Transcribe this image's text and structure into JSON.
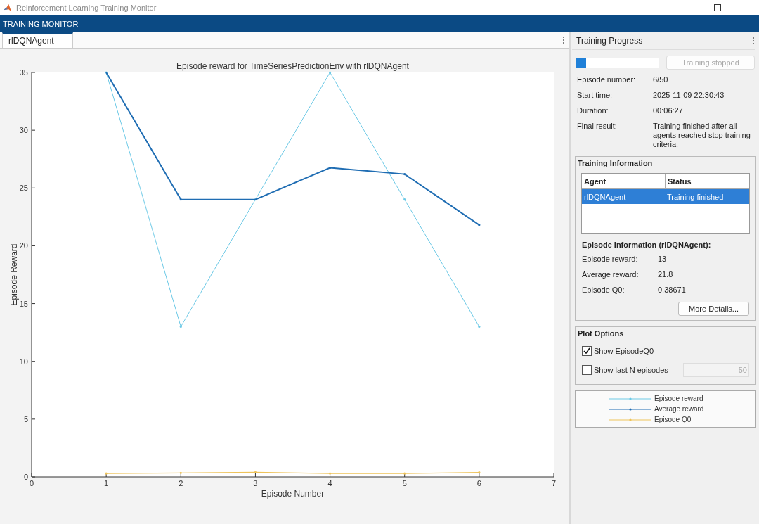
{
  "window": {
    "title": "Reinforcement Learning Training Monitor"
  },
  "header": {
    "title": "TRAINING MONITOR"
  },
  "tabs": [
    {
      "label": "rlDQNAgent",
      "selected": true
    }
  ],
  "chart": {
    "chart_data": {
      "type": "line",
      "title": "Episode reward for TimeSeriesPredictionEnv with rlDQNAgent",
      "xlabel": "Episode Number",
      "ylabel": "Episode Reward",
      "x": [
        1,
        2,
        3,
        4,
        5,
        6
      ],
      "xlim": [
        0,
        7
      ],
      "ylim": [
        0,
        35
      ],
      "xticks": [
        0,
        1,
        2,
        3,
        4,
        5,
        6,
        7
      ],
      "yticks": [
        0,
        5,
        10,
        15,
        20,
        25,
        30,
        35
      ],
      "series": [
        {
          "name": "Episode reward",
          "color": "#6cc9e6",
          "values": [
            35,
            13,
            24,
            35,
            24,
            13
          ]
        },
        {
          "name": "Average reward",
          "color": "#1f6db3",
          "values": [
            35,
            24,
            24,
            26.75,
            26.2,
            21.8
          ]
        },
        {
          "name": "Episode Q0",
          "color": "#eec35a",
          "values": [
            0.3,
            0.35,
            0.4,
            0.3,
            0.3,
            0.39
          ]
        }
      ]
    }
  },
  "progress": {
    "title": "Training Progress",
    "level": 0.12,
    "button": {
      "label": "Training stopped",
      "disabled": true
    },
    "fields": [
      {
        "label": "Episode number:",
        "value": "6/50"
      },
      {
        "label": "Start time:",
        "value": "2025-11-09 22:30:43"
      },
      {
        "label": "Duration:",
        "value": "00:06:27"
      },
      {
        "label": "Final result:",
        "value": "Training finished after all agents reached stop training criteria."
      }
    ]
  },
  "training_information": {
    "title": "Training Information",
    "columns": [
      "Agent",
      "Status"
    ],
    "rows": [
      {
        "cells": [
          "rlDQNAgent",
          "Training finished"
        ],
        "selected": true
      }
    ],
    "episode_title": "Episode Information (rlDQNAgent):",
    "fields": [
      {
        "label": "Episode reward:",
        "value": "13"
      },
      {
        "label": "Average reward:",
        "value": "21.8"
      },
      {
        "label": "Episode Q0:",
        "value": "0.38671"
      }
    ],
    "button": "More Details..."
  },
  "plot_options": {
    "title": "Plot Options",
    "options": [
      {
        "label": "Show EpisodeQ0",
        "checked": true
      },
      {
        "label": "Show last N episodes",
        "checked": false
      }
    ],
    "n_field": {
      "value": "50",
      "disabled": true
    }
  }
}
